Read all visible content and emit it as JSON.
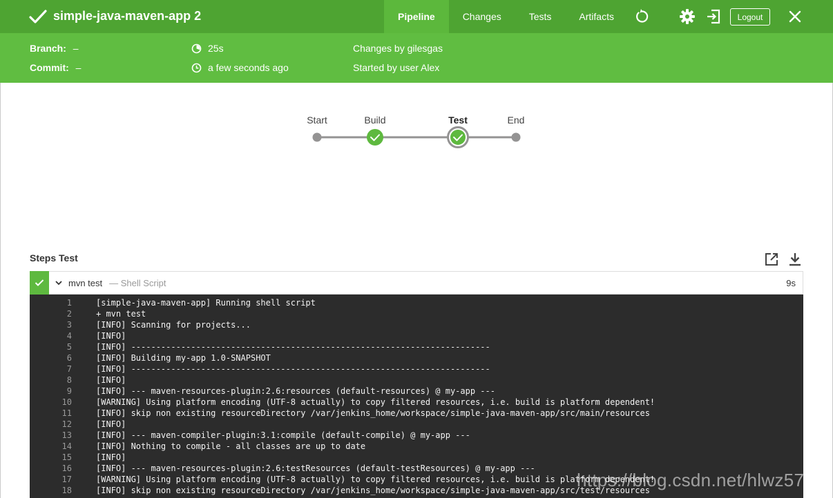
{
  "header": {
    "title": "simple-java-maven-app 2",
    "tabs": [
      {
        "label": "Pipeline",
        "active": true
      },
      {
        "label": "Changes",
        "active": false
      },
      {
        "label": "Tests",
        "active": false
      },
      {
        "label": "Artifacts",
        "active": false
      }
    ],
    "logout_label": "Logout",
    "icons": [
      "checkmark-icon",
      "replay-icon",
      "gear-icon",
      "exit-icon",
      "close-icon"
    ]
  },
  "run_info": {
    "branch_label": "Branch:",
    "branch_value": "–",
    "commit_label": "Commit:",
    "commit_value": "–",
    "duration": "25s",
    "time_ago": "a few seconds ago",
    "changes": "Changes by gilesgas",
    "started_by": "Started by user Alex"
  },
  "pipeline": {
    "stages": [
      {
        "label": "Start",
        "status": "none"
      },
      {
        "label": "Build",
        "status": "success"
      },
      {
        "label": "Test",
        "status": "success",
        "selected": true
      },
      {
        "label": "End",
        "status": "none"
      }
    ]
  },
  "steps": {
    "title": "Steps Test",
    "step_name": "mvn test",
    "step_type": "— Shell Script",
    "duration": "9s"
  },
  "log_lines": [
    "[simple-java-maven-app] Running shell script",
    "+ mvn test",
    "[INFO] Scanning for projects...",
    "[INFO]",
    "[INFO] ------------------------------------------------------------------------",
    "[INFO] Building my-app 1.0-SNAPSHOT",
    "[INFO] ------------------------------------------------------------------------",
    "[INFO]",
    "[INFO] --- maven-resources-plugin:2.6:resources (default-resources) @ my-app ---",
    "[WARNING] Using platform encoding (UTF-8 actually) to copy filtered resources, i.e. build is platform dependent!",
    "[INFO] skip non existing resourceDirectory /var/jenkins_home/workspace/simple-java-maven-app/src/main/resources",
    "[INFO]",
    "[INFO] --- maven-compiler-plugin:3.1:compile (default-compile) @ my-app ---",
    "[INFO] Nothing to compile - all classes are up to date",
    "[INFO]",
    "[INFO] --- maven-resources-plugin:2.6:testResources (default-testResources) @ my-app ---",
    "[WARNING] Using platform encoding (UTF-8 actually) to copy filtered resources, i.e. build is platform dependent!",
    "[INFO] skip non existing resourceDirectory /var/jenkins_home/workspace/simple-java-maven-app/src/test/resources"
  ],
  "watermark": "https://blog.csdn.net/hlwz5735",
  "colors": {
    "header": "#4ea432",
    "subheader": "#60bd41",
    "success": "#5eb93f",
    "log_bg": "#2c2c2c"
  }
}
